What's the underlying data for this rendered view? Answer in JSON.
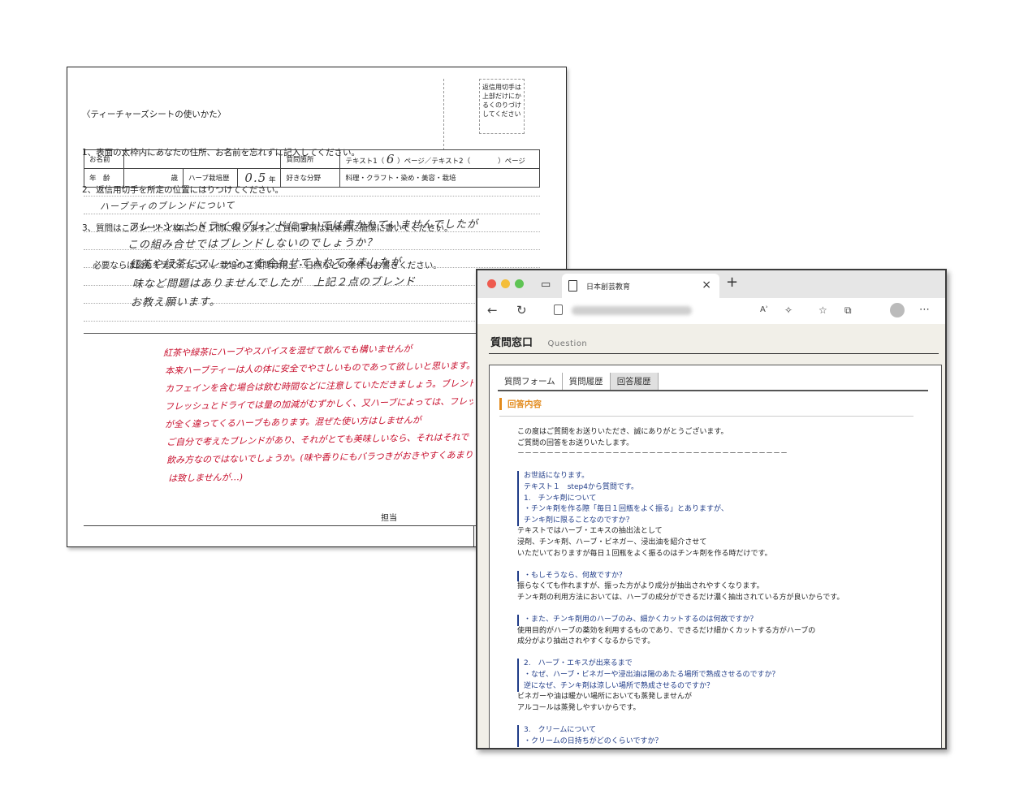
{
  "sheet": {
    "header_lines": [
      "〈ティーチャーズシートの使いかた〉",
      "1、表面の太枠内にあなたの住所、お名前を忘れずに記入してください。",
      "2、返信用切手を所定の位置にはりつけてください。",
      "3、質問はこのシート１枚につき１問に限ります。ご質問事項は具体的に簡潔に書いてください。",
      "    必要ならば図もそえてください。栽培のご質問は用土・日照などの条件もお書きください。"
    ],
    "stamp_note": "返信用切手は\n上部だけにか\nるくのりづけ\nしてください",
    "form": {
      "name_label": "お名前",
      "question_place_label": "質問箇所",
      "text_page_label": "テキスト1（",
      "text_page_value": "6",
      "text_page_suffix": "）ページ／テキスト2（　　　　）ページ",
      "age_label": "年　齢",
      "age_unit": "歳",
      "herb_years_label": "ハーブ栽培歴",
      "herb_years_value": "0.5",
      "herb_years_unit": "年",
      "fav_field_label": "好きな分野",
      "fav_field_options": "料理・クラフト・染め・美容・栽培"
    },
    "handwritten_question": [
      "ハーブティのブレンドについて",
      "フレッシュとドライのブレンドについては書かれていませんでしたが",
      "この組み合せではブレンドしないのでしょうか？",
      "紅茶や緑茶にフレッシュを合わせて入れてみましたが",
      "味など問題はありませんでしたが　上記２点のブレンド",
      "お教え願います。"
    ],
    "handwritten_answer": [
      "紅茶や緑茶にハーブやスパイスを混ぜて飲んでも構いませんが",
      "本来ハーブティーは人の体に安全でやさしいものであって欲しいと思います。",
      "カフェインを含む場合は飲む時間などに注意していただきましょう。ブレンド",
      "フレッシュとドライでは量の加減がむずかしく、又ハーブによっては、フレッシュ",
      "が全く違ってくるハーブもあります。混ぜた使い方はしませんが",
      "ご自分で考えたブレンドがあり、それがとても美味しいなら、それはそれで",
      "飲み方なのではないでしょうか。(味や香りにもバラつきがおきやすくあまり",
      "は致しませんが…)"
    ],
    "tantou_label": "担当"
  },
  "browser": {
    "tab_title": "日本創芸教育",
    "url_text": "https://seugei.jp/seugei/public/front/toppage",
    "read_aloud_icon_label": "Aʾ",
    "page_title": "質問窓口",
    "page_subtitle": "Question",
    "tabs": [
      "質問フォーム",
      "質問履歴",
      "回答履歴"
    ],
    "section_heading": "回答内容",
    "body_lines": [
      {
        "t": "この度はご質問をお送りいただき、誠にありがとうございます。",
        "q": false
      },
      {
        "t": "ご質問の回答をお送りいたします。",
        "q": false
      },
      {
        "t": "－－－－－－－－－－－－－－－－－－－－－－－－－－－－－－－－－－－－－",
        "q": false
      },
      {
        "t": "",
        "q": false
      },
      {
        "t": "お世話になります。",
        "q": true
      },
      {
        "t": "テキスト１　step4から質問です。",
        "q": true
      },
      {
        "t": "1.　チンキ剤について",
        "q": true
      },
      {
        "t": "・チンキ剤を作る際「毎日１回瓶をよく振る」とありますが、",
        "q": true
      },
      {
        "t": "チンキ剤に限ることなのですか？",
        "q": true
      },
      {
        "t": "テキストではハーブ・エキスの抽出法として",
        "q": false
      },
      {
        "t": "浸剤、チンキ剤、ハーブ・ビネガー、浸出油を紹介させて",
        "q": false
      },
      {
        "t": "いただいておりますが毎日１回瓶をよく振るのはチンキ剤を作る時だけです。",
        "q": false
      },
      {
        "t": "",
        "q": false
      },
      {
        "t": "・もしそうなら、何故ですか？",
        "q": true
      },
      {
        "t": "振らなくても作れますが、振った方がより成分が抽出されやすくなります。",
        "q": false
      },
      {
        "t": "チンキ剤の利用方法においては、ハーブの成分ができるだけ濃く抽出されている方が良いからです。",
        "q": false
      },
      {
        "t": "",
        "q": false
      },
      {
        "t": "・また、チンキ剤用のハーブのみ、細かくカットするのは何故ですか？",
        "q": true
      },
      {
        "t": "使用目的がハーブの薬効を利用するものであり、できるだけ細かくカットする方がハーブの",
        "q": false
      },
      {
        "t": "成分がより抽出されやすくなるからです。",
        "q": false
      },
      {
        "t": "",
        "q": false
      },
      {
        "t": "2.　ハーブ・エキスが出来るまで",
        "q": true
      },
      {
        "t": "・なぜ、ハーブ・ビネガーや浸出油は陽のあたる場所で熟成させるのですか？",
        "q": true
      },
      {
        "t": "逆になぜ、チンキ剤は涼しい場所で熟成させるのですか？",
        "q": true
      },
      {
        "t": "ビネガーや油は暖かい場所においても蒸発しませんが",
        "q": false
      },
      {
        "t": "アルコールは蒸発しやすいからです。",
        "q": false
      },
      {
        "t": "",
        "q": false
      },
      {
        "t": "3.　クリームについて",
        "q": true
      },
      {
        "t": "・クリームの日持ちがどのくらいですか？",
        "q": true
      }
    ]
  }
}
